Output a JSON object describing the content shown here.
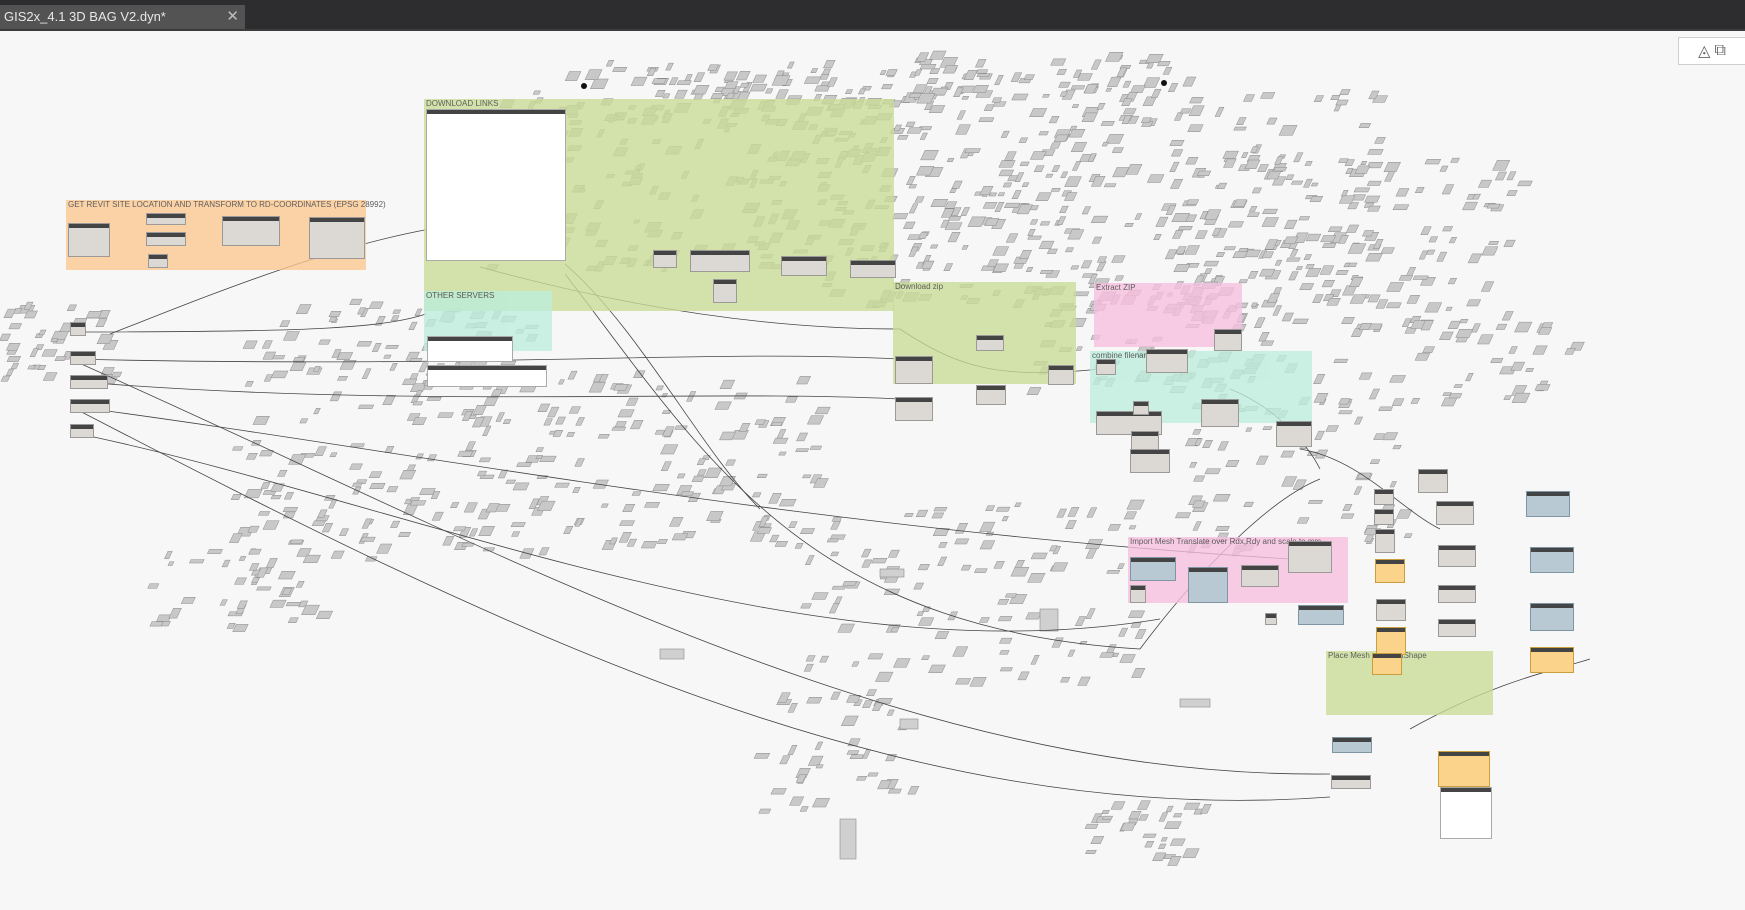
{
  "tab": {
    "title": "GIS2x_4.1 3D BAG V2.dyn*",
    "close": "✕"
  },
  "view_controls": {
    "geometry_icon": "◬",
    "graph_icon": "⧉"
  },
  "groups": [
    {
      "name": "get-revit-site-location-group",
      "title": "GET REVIT SITE LOCATION AND TRANSFORM TO RD-COORDINATES (EPSG 28992)",
      "color": "#fcc88f"
    },
    {
      "name": "download-links-group",
      "title": "DOWNLOAD LINKS",
      "color": "#c9dd95"
    },
    {
      "name": "other-servers-group",
      "title": "OTHER SERVERS",
      "color": "#bdeedd"
    },
    {
      "name": "download-zip-group",
      "title": "Download zip",
      "color": "#c9dd95"
    },
    {
      "name": "extract-zip-group",
      "title": "Extract ZIP",
      "color": "#f9bfe0"
    },
    {
      "name": "combine-filename-group",
      "title": "combine filename .obj",
      "color": "#bdeedd"
    },
    {
      "name": "import-mesh-group",
      "title": "Import Mesh Translate over Rdx,Rdy and scale to mm",
      "color": "#f9bfe0"
    },
    {
      "name": "place-mesh-group",
      "title": "Place Mesh as DirectShape",
      "color": "#c9dd95"
    }
  ],
  "colors": {
    "tabbar": "#2d2d30",
    "tab": "#535353",
    "background": "#f7f7f7",
    "building": "#c8c8c8",
    "wire": "#444444"
  }
}
